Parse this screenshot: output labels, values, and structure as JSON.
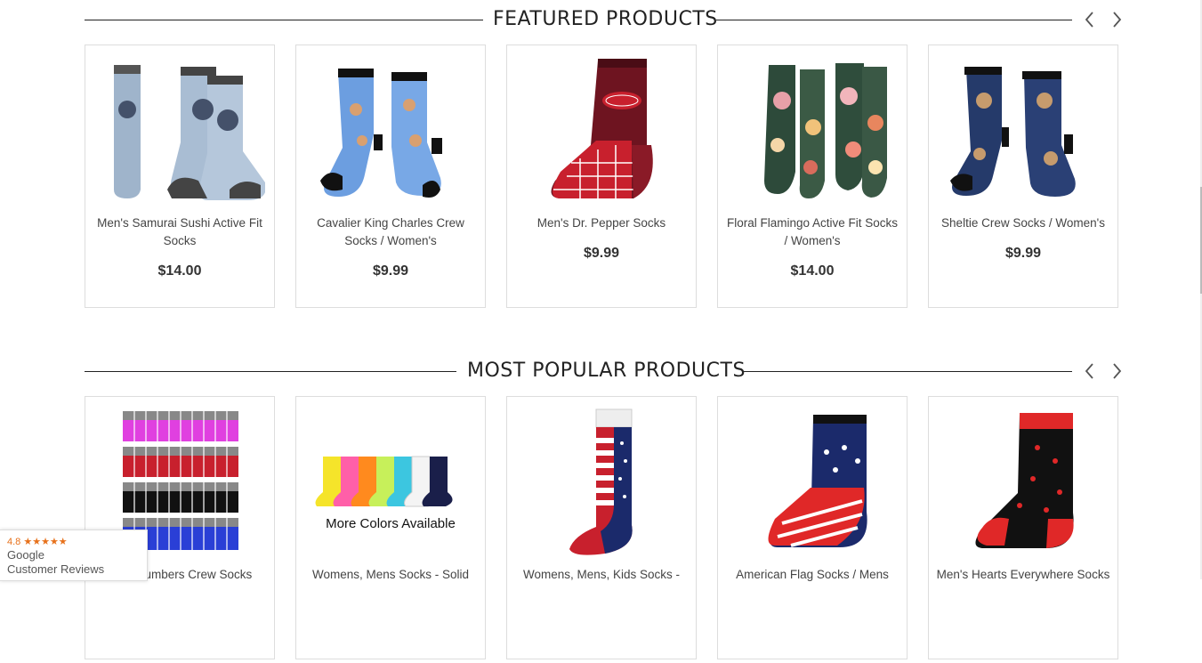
{
  "featured": {
    "title": "FEATURED PRODUCTS",
    "products": [
      {
        "name": "Men's Samurai Sushi Active Fit Socks",
        "price": "$14.00"
      },
      {
        "name": "Cavalier King Charles Crew Socks / Women's",
        "price": "$9.99"
      },
      {
        "name": "Men's Dr. Pepper Socks",
        "price": "$9.99"
      },
      {
        "name": "Floral Flamingo Active Fit Socks / Women's",
        "price": "$14.00"
      },
      {
        "name": "Sheltie Crew Socks / Women's",
        "price": "$9.99"
      }
    ]
  },
  "popular": {
    "title": "MOST POPULAR PRODUCTS",
    "products": [
      {
        "name": "Numbers Crew Socks"
      },
      {
        "name": "Womens, Mens Socks - Solid",
        "image_text": "More  Colors  Available"
      },
      {
        "name": "Womens, Mens, Kids Socks -"
      },
      {
        "name": "American Flag Socks / Mens"
      },
      {
        "name": "Men's Hearts Everywhere Socks"
      }
    ]
  },
  "badge": {
    "rating": "4.8",
    "stars": "★★★★★",
    "brand": "Google",
    "label": "Customer Reviews"
  },
  "colors": {
    "star": "#e7711b",
    "rule": "#222222",
    "card_border": "#dddddd"
  }
}
